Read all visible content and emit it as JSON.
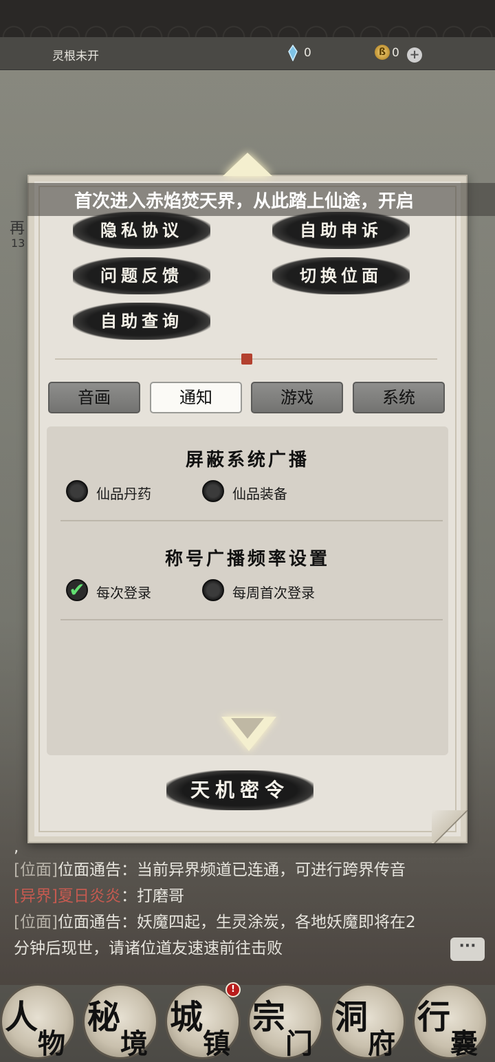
{
  "statusbar": {
    "root_label": "灵根未开",
    "gem_value": "0",
    "coin_value": "0",
    "coin_glyph": "ß",
    "plus_glyph": "+"
  },
  "background": {
    "side_text": "再",
    "side_num": "13"
  },
  "dialog": {
    "marquee_text": "首次进入赤焰焚天界，从此踏上仙途，开启",
    "menu_buttons": [
      {
        "label": "隐私协议"
      },
      {
        "label": "自助申诉"
      },
      {
        "label": "问题反馈"
      },
      {
        "label": "切换位面"
      },
      {
        "label": "自助查询"
      }
    ],
    "tabs": [
      {
        "label": "音画",
        "active": false
      },
      {
        "label": "通知",
        "active": true
      },
      {
        "label": "游戏",
        "active": false
      },
      {
        "label": "系统",
        "active": false
      }
    ],
    "sections": [
      {
        "title": "屏蔽系统广播",
        "options": [
          {
            "label": "仙品丹药",
            "checked": false
          },
          {
            "label": "仙品装备",
            "checked": false
          }
        ]
      },
      {
        "title": "称号广播频率设置",
        "options": [
          {
            "label": "每次登录",
            "checked": true
          },
          {
            "label": "每周首次登录",
            "checked": false
          }
        ]
      }
    ],
    "secret_button": "天机密令",
    "check_glyph": "✔"
  },
  "chat": {
    "lead": ",",
    "messages": [
      {
        "tag": "[位面]",
        "speaker": "位面通告",
        "sep": "：",
        "text": "当前异界频道已连通，可进行跨界传音"
      },
      {
        "tag": "[异界]",
        "speaker": "夏日炎炎",
        "sep": "：",
        "text": "打磨哥"
      },
      {
        "tag": "[位面]",
        "speaker": "位面通告",
        "sep": "：",
        "text": "妖魔四起，生灵涂炭，各地妖魔即将在2分钟后现世，请诸位道友速速前往击败"
      }
    ],
    "toggle_glyph": "···"
  },
  "bottom_nav": {
    "badge": "!",
    "items": [
      {
        "c1": "人",
        "c2": "物"
      },
      {
        "c1": "秘",
        "c2": "境"
      },
      {
        "c1": "城",
        "c2": "镇"
      },
      {
        "c1": "宗",
        "c2": "门"
      },
      {
        "c1": "洞",
        "c2": "府"
      },
      {
        "c1": "行",
        "c2": "囊"
      }
    ]
  },
  "colors": {
    "accent_red": "#c55a50",
    "check_green": "#62e072",
    "panel_bg": "#e6e2da"
  }
}
